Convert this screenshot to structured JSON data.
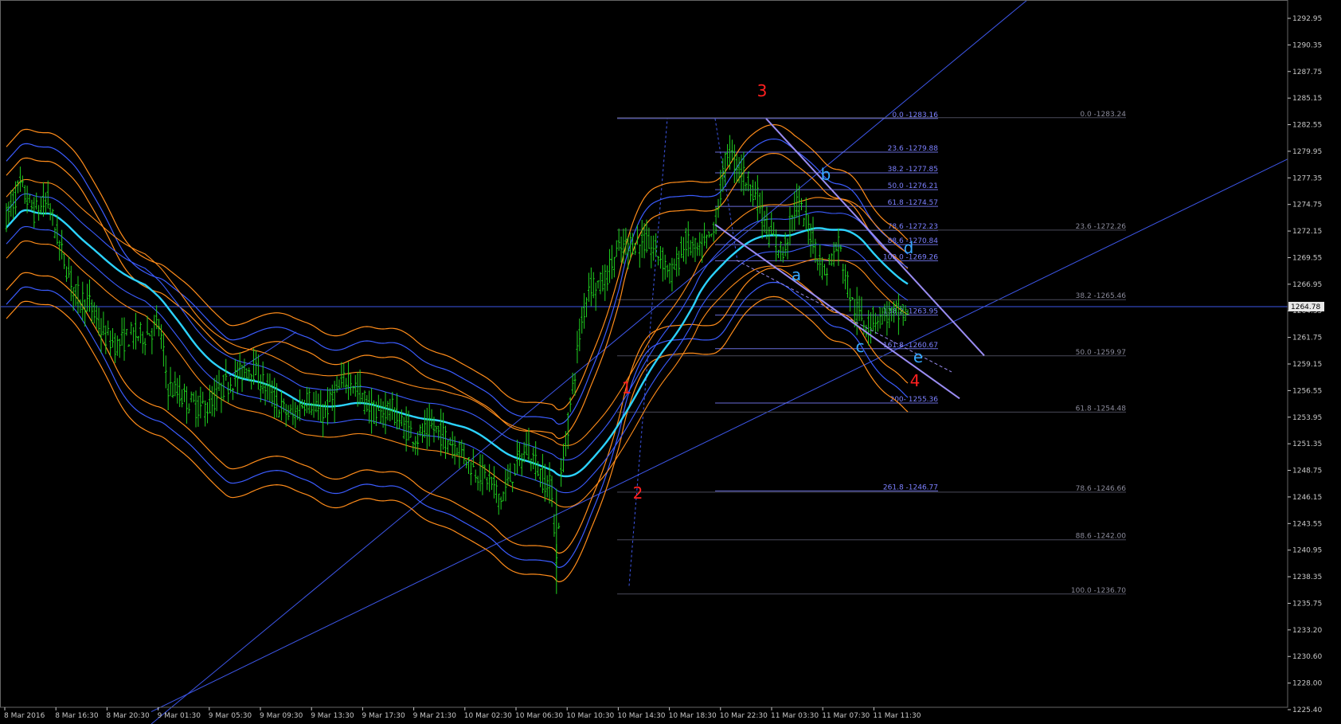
{
  "chart_data": {
    "type": "candlestick",
    "symbol": "",
    "ylim": [
      1223.5,
      1297.5
    ],
    "y_ticks": [
      "1292.95",
      "1290.35",
      "1287.75",
      "1285.15",
      "1282.55",
      "1279.95",
      "1277.35",
      "1274.75",
      "1272.15",
      "1269.55",
      "1266.95",
      "1264.35",
      "1261.75",
      "1259.15",
      "1256.55",
      "1253.95",
      "1251.35",
      "1248.75",
      "1246.15",
      "1243.55",
      "1240.95",
      "1238.35",
      "1235.75",
      "1233.20",
      "1230.60",
      "1228.00",
      "1225.40"
    ],
    "x_ticks": [
      "8 Mar 2016",
      "8 Mar 16:30",
      "8 Mar 20:30",
      "9 Mar 01:30",
      "9 Mar 05:30",
      "9 Mar 09:30",
      "9 Mar 13:30",
      "9 Mar 17:30",
      "9 Mar 21:30",
      "10 Mar 02:30",
      "10 Mar 06:30",
      "10 Mar 10:30",
      "10 Mar 14:30",
      "10 Mar 18:30",
      "10 Mar 22:30",
      "11 Mar 03:30",
      "11 Mar 07:30",
      "11 Mar 11:30"
    ],
    "current_price": "1264.78",
    "price_path": [
      [
        0,
        1273.5
      ],
      [
        6,
        1276.5
      ],
      [
        12,
        1274
      ],
      [
        18,
        1275
      ],
      [
        24,
        1270
      ],
      [
        30,
        1266
      ],
      [
        36,
        1265
      ],
      [
        42,
        1262
      ],
      [
        48,
        1261
      ],
      [
        54,
        1262
      ],
      [
        60,
        1262
      ],
      [
        66,
        1263
      ],
      [
        70,
        1257
      ],
      [
        76,
        1256
      ],
      [
        82,
        1255
      ],
      [
        88,
        1255
      ],
      [
        94,
        1257
      ],
      [
        100,
        1258
      ],
      [
        106,
        1259
      ],
      [
        112,
        1257
      ],
      [
        118,
        1255
      ],
      [
        124,
        1254
      ],
      [
        130,
        1256
      ],
      [
        136,
        1254
      ],
      [
        142,
        1256
      ],
      [
        148,
        1258
      ],
      [
        154,
        1256
      ],
      [
        160,
        1254
      ],
      [
        166,
        1255
      ],
      [
        172,
        1253
      ],
      [
        178,
        1252
      ],
      [
        184,
        1253
      ],
      [
        190,
        1252
      ],
      [
        196,
        1251
      ],
      [
        202,
        1249
      ],
      [
        208,
        1248
      ],
      [
        214,
        1246
      ],
      [
        220,
        1249
      ],
      [
        226,
        1251
      ],
      [
        232,
        1248
      ],
      [
        236,
        1247
      ],
      [
        238,
        1240
      ],
      [
        240,
        1248
      ],
      [
        244,
        1255
      ],
      [
        248,
        1262
      ],
      [
        252,
        1267
      ],
      [
        258,
        1267
      ],
      [
        264,
        1270
      ],
      [
        270,
        1271
      ],
      [
        276,
        1271
      ],
      [
        282,
        1270
      ],
      [
        288,
        1268
      ],
      [
        294,
        1271
      ],
      [
        300,
        1270
      ],
      [
        306,
        1272
      ],
      [
        312,
        1280
      ],
      [
        318,
        1278
      ],
      [
        324,
        1276
      ],
      [
        330,
        1272
      ],
      [
        336,
        1270
      ],
      [
        342,
        1275
      ],
      [
        348,
        1272
      ],
      [
        354,
        1268
      ],
      [
        360,
        1271
      ],
      [
        366,
        1265
      ],
      [
        372,
        1263
      ],
      [
        378,
        1264
      ],
      [
        384,
        1264
      ],
      [
        390,
        1264
      ]
    ],
    "fib_labels": [
      "0.0 -1283.16",
      "23.6 -1279.88",
      "38.2 -1277.85",
      "50.0 -1276.21",
      "61.8 -1274.57",
      "78.6 -1272.23",
      "88.6 -1270.84",
      "100.0 -1269.26",
      "138.2 -1263.95",
      "161.8 -1260.67",
      "200- 1255.36",
      "261.8 -1246.77"
    ],
    "fib_values": [
      1283.16,
      1279.88,
      1277.85,
      1276.21,
      1274.57,
      1272.23,
      1270.84,
      1269.26,
      1263.95,
      1260.67,
      1255.36,
      1246.77
    ],
    "fib2_labels": [
      "0.0 -1283.24",
      "23.6 -1272.26",
      "38.2 -1265.46",
      "50.0 -1259.97",
      "61.8 -1254.48",
      "78.6 -1246.66",
      "88.6 -1242.00",
      "100.0 -1236.70"
    ],
    "fib2_values": [
      1283.24,
      1272.26,
      1265.46,
      1259.97,
      1254.48,
      1246.66,
      1242.0,
      1236.7
    ],
    "wave_labels_red": [
      "1",
      "2",
      "3",
      "4"
    ],
    "wave_labels_blue": [
      "a",
      "b",
      "c",
      "d",
      "e"
    ],
    "colors": {
      "candle": "#1fd21f",
      "band_outer": "#ff8c1a",
      "band_inner": "#3b5cff",
      "mid_line": "#2cd3ff",
      "trendline": "#3d56e8",
      "channel": "#9a8cf2",
      "fib": "#7c80ff",
      "fib2": "#4a4a5a",
      "axis": "#c8c8c8",
      "wave_red": "#ff2020",
      "wave_blue": "#35a8ff"
    }
  }
}
